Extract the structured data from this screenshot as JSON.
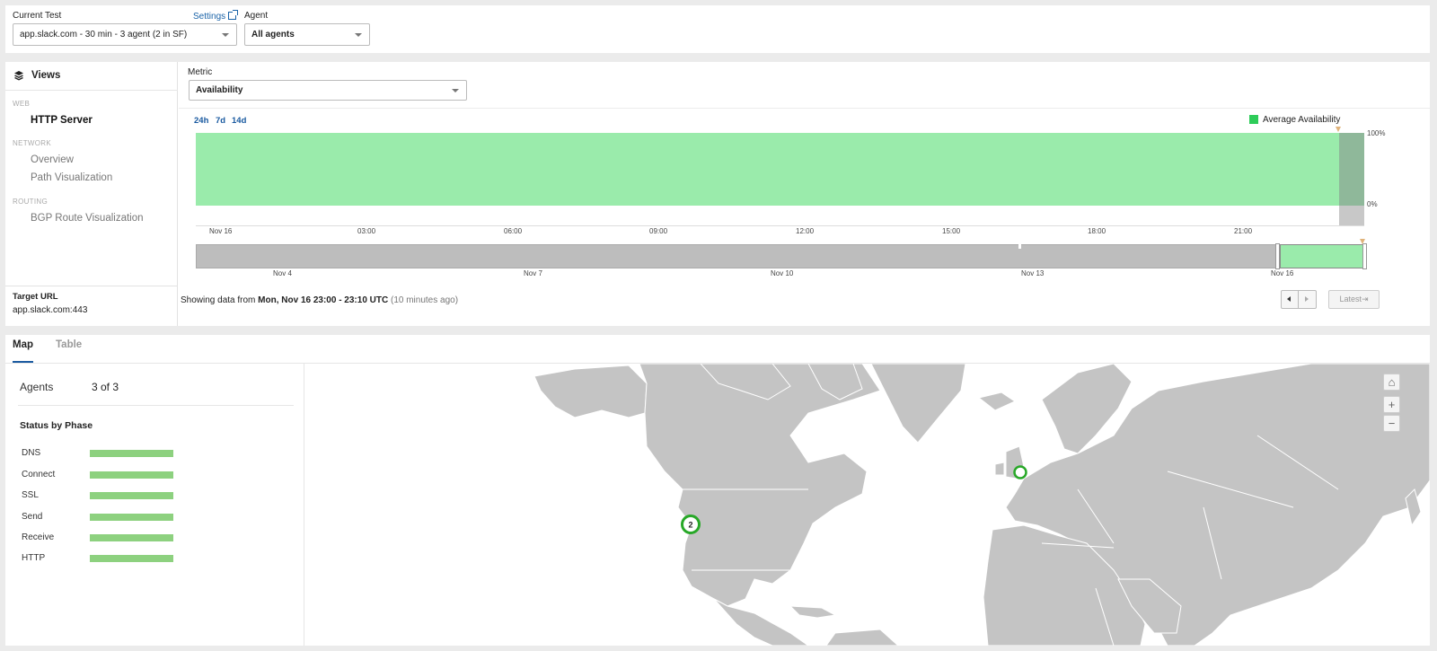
{
  "top": {
    "current_test_label": "Current Test",
    "current_test_value": "app.slack.com - 30 min - 3 agent (2 in SF)",
    "settings_label": "Settings",
    "agent_label": "Agent",
    "agent_value": "All agents"
  },
  "views": {
    "title": "Views",
    "sections": [
      {
        "name": "WEB",
        "items": [
          "HTTP Server"
        ]
      },
      {
        "name": "NETWORK",
        "items": [
          "Overview",
          "Path Visualization"
        ]
      },
      {
        "name": "ROUTING",
        "items": [
          "BGP Route Visualization"
        ]
      }
    ],
    "active_item": "HTTP Server",
    "target_url_label": "Target URL",
    "target_url_value": "app.slack.com:443"
  },
  "metric": {
    "label": "Metric",
    "value": "Availability"
  },
  "timeline": {
    "ranges": [
      "24h",
      "7d",
      "14d"
    ],
    "legend": "Average Availability",
    "y_top": "100%",
    "y_bottom": "0%",
    "ticks": [
      "Nov 16",
      "03:00",
      "06:00",
      "09:00",
      "12:00",
      "15:00",
      "18:00",
      "21:00"
    ],
    "overview_ticks": [
      "Nov 4",
      "Nov 7",
      "Nov 10",
      "Nov 13",
      "Nov 16"
    ],
    "showing_prefix": "Showing data from ",
    "showing_bold": "Mon, Nov 16 23:00 - 23:10 UTC",
    "showing_suffix": " (10 minutes ago)",
    "latest_label": "Latest⇥"
  },
  "chart_data": {
    "type": "area",
    "series": [
      {
        "name": "Average Availability",
        "values": [
          100
        ]
      }
    ],
    "ylim": [
      0,
      100
    ],
    "colors": {
      "availability": "#9aebab",
      "legend": "#2ecc59"
    }
  },
  "map_tabs": {
    "tabs": [
      "Map",
      "Table"
    ],
    "active": "Map"
  },
  "agents": {
    "label": "Agents",
    "value": "3 of 3"
  },
  "status_by_phase": {
    "title": "Status by Phase",
    "phases": [
      "DNS",
      "Connect",
      "SSL",
      "Send",
      "Receive",
      "HTTP"
    ]
  },
  "map": {
    "cluster_count": "2",
    "land_color": "#c4c4c4",
    "marker_color": "#28a828"
  }
}
